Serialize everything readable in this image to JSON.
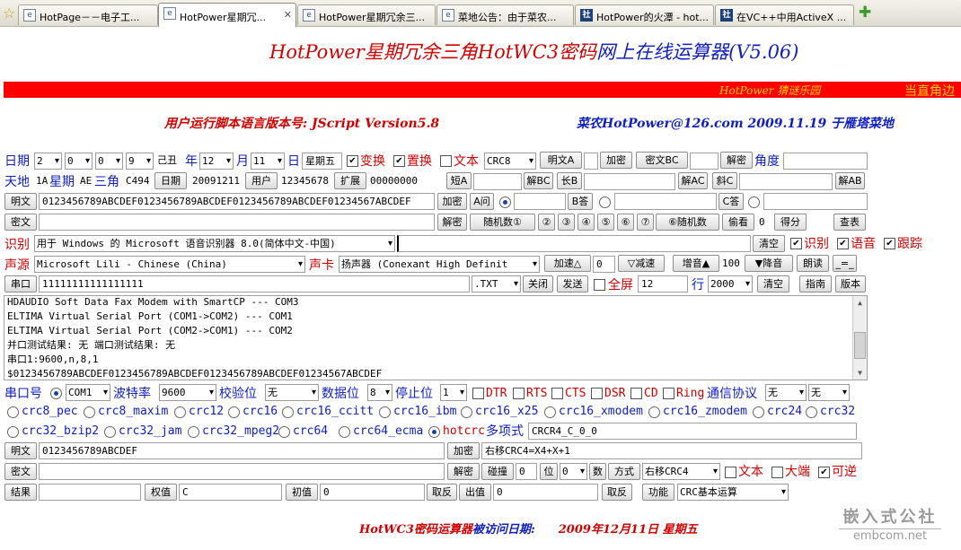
{
  "tabs": [
    {
      "label": "HotPage－－电子工...",
      "icon": "page-icon"
    },
    {
      "label": "HotPower星期冗...",
      "icon": "page-icon",
      "active": true
    },
    {
      "label": "HotPower星期冗余三...",
      "icon": "page-icon"
    },
    {
      "label": "菜地公告：由于菜农...",
      "icon": "page-icon"
    },
    {
      "label": "HotPower的火潭 - hot...",
      "icon": "forum-icon"
    },
    {
      "label": "在VC++中用ActiveX ...",
      "icon": "forum-icon"
    }
  ],
  "title": {
    "part1": "HotPower星期冗余三角HotWC3密码",
    "part2": "网上在线运算器(V5.06)"
  },
  "banner": {
    "left": "HotPower 猜谜乐园",
    "right": "当直角边"
  },
  "version_line": {
    "text": "用户运行脚本语言版本号:  JScript Version5.8",
    "author": "菜农HotPower@126.com  2009.11.19 于雁塔菜地"
  },
  "row1": {
    "date_label": "日期",
    "d1": "2",
    "d2": "0",
    "d3": "0",
    "d4": "9",
    "ganzhi": "己丑",
    "year_label": "年",
    "month": "12",
    "month_label": "月",
    "day": "11",
    "day_label": "日",
    "weekday": "星期五",
    "transform": "变换",
    "replace": "置换",
    "text": "文本",
    "crc": "CRC8",
    "plain_a": "明文A",
    "encrypt": "加密",
    "cipher_bc": "密文BC",
    "decrypt": "解密",
    "angle": "角度"
  },
  "row2": {
    "sky_earth": "天地",
    "v1": "1A",
    "week": "星期",
    "v2": "AE",
    "triangle": "三角",
    "v3": "C494",
    "date_btn": "日期",
    "v4": "20091211",
    "user_btn": "用户",
    "v5": "12345678",
    "ext_btn": "扩展",
    "v6": "00000000",
    "short_a": "短A",
    "dec_bc": "解BC",
    "long_b": "长B",
    "dec_ac": "解AC",
    "slant_c": "斜C",
    "dec_ab": "解AB"
  },
  "row3": {
    "plain": "明文",
    "value": "0123456789ABCDEF0123456789ABCDEF0123456789ABCDEF01234567ABCDEF",
    "encrypt": "加密",
    "a_ask": "A问",
    "b_ans": "B答",
    "c_ans": "C答"
  },
  "row4": {
    "cipher": "密文",
    "decrypt": "解密",
    "random1": "随机数①",
    "n2": "②",
    "n3": "③",
    "n4": "④",
    "n5": "⑤",
    "n6": "⑥",
    "n7": "⑦",
    "random6": "⑥随机数",
    "peek": "偷看",
    "count": "0",
    "score": "得分",
    "lookup": "查表"
  },
  "row5": {
    "recognize_label": "识别",
    "engine": "用于 Windows 的 Microsoft 语音识别器 8.0(简体中文-中国)",
    "clear": "清空",
    "rec_chk": "识别",
    "voice_chk": "语音",
    "track_chk": "跟踪"
  },
  "row6": {
    "voice_src": "声源",
    "voice": "Microsoft Lili - Chinese (China)",
    "card": "声卡",
    "speaker": "扬声器 (Conexant High Definit",
    "speed_up": "加速△",
    "speed_val": "0",
    "slow": "▽减速",
    "vol_up": "增音▲",
    "vol_val": "100",
    "vol_down": "▼降音",
    "read": "朗读",
    "eq": "_=_"
  },
  "row7": {
    "port_btn": "串口",
    "value": "11111111111111111",
    "ext": ".TXT",
    "close": "关闭",
    "send": "发送",
    "fullscreen": "全屏",
    "full_val": "12",
    "line_label": "行",
    "lines": "2000",
    "clear": "清空",
    "guide": "指南",
    "version": "版本"
  },
  "log": [
    "HDAUDIO Soft Data Fax Modem with SmartCP --- COM3",
    "ELTIMA Virtual Serial Port (COM1->COM2) --- COM1",
    "ELTIMA Virtual Serial Port (COM2->COM1) --- COM2",
    "并口测试结果: 无  端口测试结果: 无",
    "串口1:9600,n,8,1",
    "$0123456789ABCDEF0123456789ABCDEF0123456789ABCDEF01234567ABCDEF"
  ],
  "serial": {
    "port_label": "串口号",
    "port": "COM1",
    "baud_label": "波特率",
    "baud": "9600",
    "parity_label": "校验位",
    "parity": "无",
    "data_label": "数据位",
    "data": "8",
    "stop_label": "停止位",
    "stop": "1",
    "dtr": "DTR",
    "rts": "RTS",
    "cts": "CTS",
    "dsr": "DSR",
    "cd": "CD",
    "ring": "Ring",
    "proto_label": "通信协议",
    "proto1": "无",
    "proto2": "无"
  },
  "crc_row1": [
    "crc8_pec",
    "crc8_maxim",
    "crc12",
    "crc16",
    "crc16_ccitt",
    "crc16_ibm",
    "crc16_x25",
    "crc16_xmodem",
    "crc16_zmodem",
    "crc24",
    "crc32"
  ],
  "crc_row2": [
    "crc32_bzip2",
    "crc32_jam",
    "crc32_mpeg2",
    "crc64",
    "crc64_ecma",
    "hotcrc"
  ],
  "poly_label": "多项式",
  "poly_value": "CRCR4_C_0_0",
  "crc_plain": {
    "label": "明文",
    "value": "0123456789ABCDEF",
    "encrypt": "加密",
    "result": "右移CRC4=X4+X+1"
  },
  "crc_cipher": {
    "label": "密文",
    "decrypt": "解密",
    "collide": "碰撞",
    "cval": "0",
    "bit": "位",
    "bitval": "0",
    "num": "数",
    "mode": "方式",
    "mode_val": "右移CRC4",
    "text": "文本",
    "big_endian": "大端",
    "reversible": "可逆"
  },
  "result_row": {
    "result": "结果",
    "weight": "权值",
    "weight_val": "C",
    "init": "初值",
    "init_val": "0",
    "invert1": "取反",
    "out": "出值",
    "out_val": "0",
    "invert2": "取反",
    "func": "功能",
    "func_val": "CRC基本运算"
  },
  "footer": {
    "part1": "HotWC3密码运算器",
    "part2": "被访问日期:",
    "date": "2009年12月11日   星期五"
  },
  "watermark": {
    "top": "嵌入式公社",
    "bottom": "embcom.net"
  },
  "colors": {
    "blue": "#1020c0",
    "red": "#d00000",
    "banner_red": "#ff0000",
    "banner_text": "#ffd000"
  }
}
